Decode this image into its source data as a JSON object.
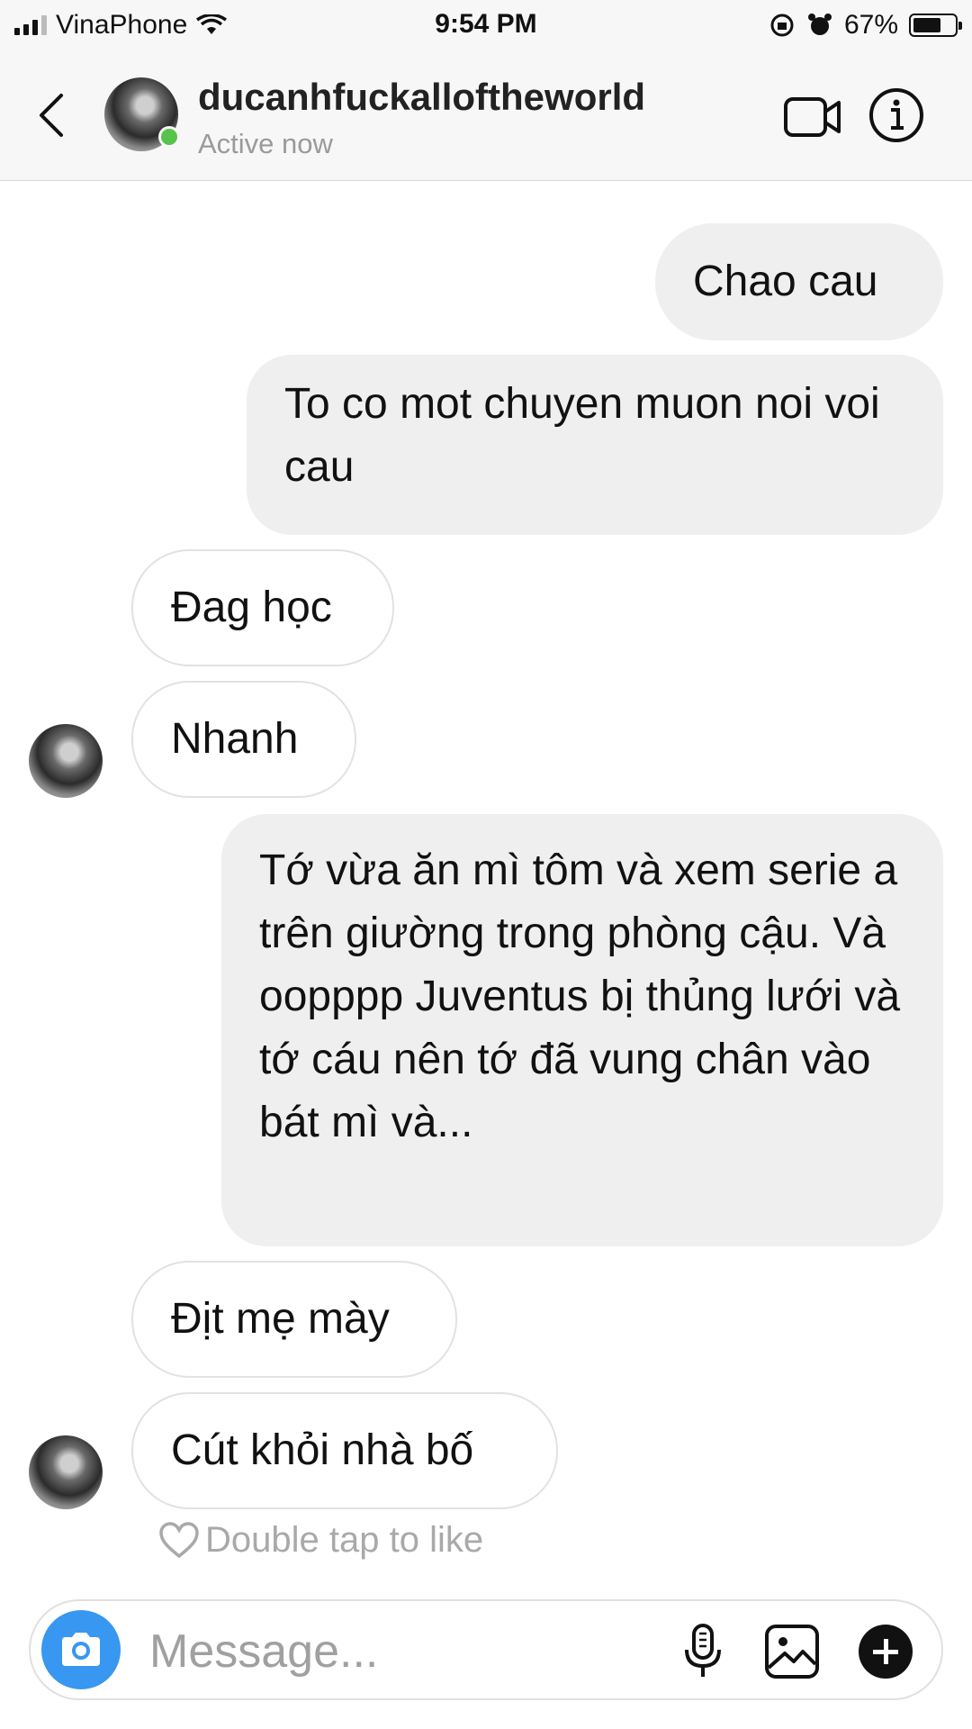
{
  "status_bar": {
    "carrier": "VinaPhone",
    "time": "9:54 PM",
    "battery": "67%",
    "battery_level": 0.67
  },
  "header": {
    "username": "ducanhfuckalloftheworld",
    "presence": "Active now"
  },
  "messages": [
    {
      "side": "out",
      "text": "Chao cau"
    },
    {
      "side": "out",
      "text": "To co mot chuyen muon noi voi cau"
    },
    {
      "side": "in",
      "text": "Đag học"
    },
    {
      "side": "in",
      "text": "Nhanh"
    },
    {
      "side": "out",
      "text": "Tớ vừa ăn mì tôm và xem serie a trên giường trong phòng cậu. Và oopppp Juventus bị thủng lưới và tớ cáu nên tớ đã vung chân vào bát mì và..."
    },
    {
      "side": "in",
      "text": "Địt mẹ mày"
    },
    {
      "side": "in",
      "text": "Cút khỏi nhà bố"
    }
  ],
  "like_hint": "Double tap to like",
  "composer": {
    "placeholder": "Message..."
  },
  "icons": [
    "back-chevron-icon",
    "video-call-icon",
    "info-icon",
    "heart-icon",
    "camera-icon",
    "microphone-icon",
    "gallery-icon",
    "plus-icon"
  ],
  "colors": {
    "accent": "#3897f0",
    "online": "#57c34b",
    "outgoing_bubble": "#efefef"
  }
}
